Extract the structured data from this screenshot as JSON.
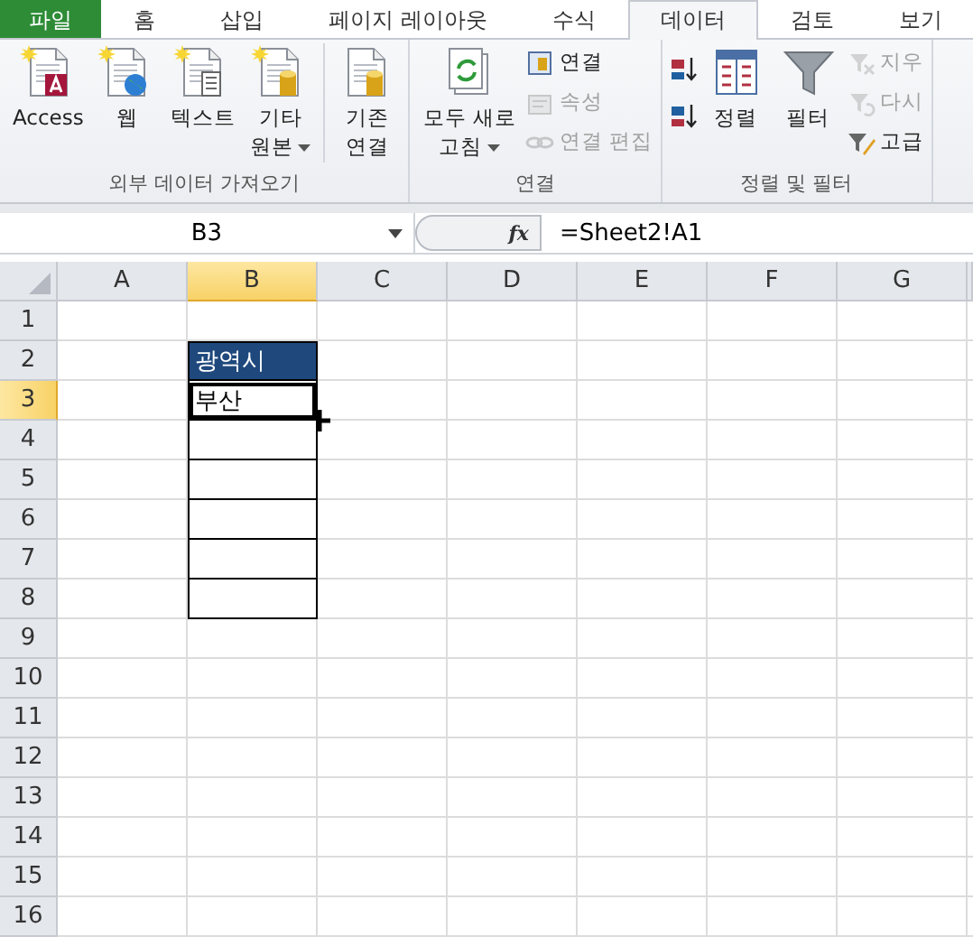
{
  "tabs": [
    {
      "label": "파일",
      "kind": "file",
      "selected": false
    },
    {
      "label": "홈",
      "kind": "tab",
      "selected": false
    },
    {
      "label": "삽입",
      "kind": "tab",
      "selected": false
    },
    {
      "label": "페이지 레이아웃",
      "kind": "tab",
      "selected": false
    },
    {
      "label": "수식",
      "kind": "tab",
      "selected": false
    },
    {
      "label": "데이터",
      "kind": "tab",
      "selected": true
    },
    {
      "label": "검토",
      "kind": "tab",
      "selected": false
    },
    {
      "label": "보기",
      "kind": "tab",
      "selected": false
    }
  ],
  "ribbon": {
    "groups": [
      {
        "label": "외부 데이터 가져오기",
        "items": [
          {
            "kind": "large",
            "label": "Access",
            "dropdown": false,
            "disabled": false
          },
          {
            "kind": "large",
            "label": "웹",
            "dropdown": false,
            "disabled": false
          },
          {
            "kind": "large",
            "label": "텍스트",
            "dropdown": false,
            "disabled": false
          },
          {
            "kind": "large",
            "label": "기타\n원본",
            "dropdown": true,
            "disabled": false
          },
          {
            "kind": "separator"
          },
          {
            "kind": "large",
            "label": "기존\n연결",
            "dropdown": false,
            "disabled": false
          }
        ]
      },
      {
        "label": "연결",
        "items": [
          {
            "kind": "large",
            "label": "모두 새로\n고침",
            "dropdown": true,
            "disabled": false
          },
          {
            "kind": "small",
            "label": "연결",
            "disabled": false
          },
          {
            "kind": "small",
            "label": "속성",
            "disabled": true
          },
          {
            "kind": "small",
            "label": "연결 편집",
            "disabled": true
          }
        ]
      },
      {
        "label": "정렬 및 필터",
        "items": [
          {
            "kind": "sort",
            "disabled": false
          },
          {
            "kind": "sort",
            "disabled": false
          },
          {
            "kind": "large",
            "label": "정렬",
            "dropdown": false,
            "disabled": false
          },
          {
            "kind": "large",
            "label": "필터",
            "dropdown": false,
            "disabled": false
          },
          {
            "kind": "small",
            "label": "지우",
            "disabled": true
          },
          {
            "kind": "small",
            "label": "다시",
            "disabled": true
          },
          {
            "kind": "small",
            "label": "고급",
            "disabled": false
          }
        ]
      }
    ]
  },
  "formula_bar": {
    "name_box": "B3",
    "function_label": "fx",
    "formula": "=Sheet2!A1"
  },
  "sheet": {
    "columns": [
      {
        "label": "A",
        "selected": false
      },
      {
        "label": "B",
        "selected": true
      },
      {
        "label": "C",
        "selected": false
      },
      {
        "label": "D",
        "selected": false
      },
      {
        "label": "E",
        "selected": false
      },
      {
        "label": "F",
        "selected": false
      },
      {
        "label": "G",
        "selected": false
      }
    ],
    "rows": [
      {
        "label": "1",
        "selected": false
      },
      {
        "label": "2",
        "selected": false
      },
      {
        "label": "3",
        "selected": true
      },
      {
        "label": "4",
        "selected": false
      },
      {
        "label": "5",
        "selected": false
      },
      {
        "label": "6",
        "selected": false
      },
      {
        "label": "7",
        "selected": false
      },
      {
        "label": "8",
        "selected": false
      },
      {
        "label": "9",
        "selected": false
      },
      {
        "label": "10",
        "selected": false
      },
      {
        "label": "11",
        "selected": false
      },
      {
        "label": "12",
        "selected": false
      },
      {
        "label": "13",
        "selected": false
      },
      {
        "label": "14",
        "selected": false
      },
      {
        "label": "15",
        "selected": false
      },
      {
        "label": "16",
        "selected": false
      }
    ],
    "table": {
      "header": "광역시",
      "values": [
        {
          "text": "부산",
          "selected": true
        }
      ]
    }
  }
}
